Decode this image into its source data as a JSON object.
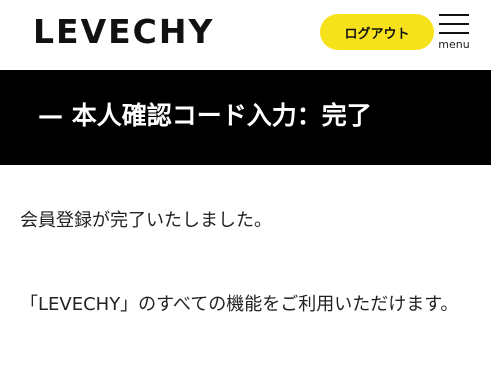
{
  "header": {
    "logo_text": "LEVECHY",
    "logout_label": "ログアウト",
    "menu_label": "menu",
    "logout_color": "#f6e21b"
  },
  "title_bar": {
    "title": "— 本人確認コード入力：完了",
    "background": "#000000"
  },
  "content": {
    "message_1": "会員登録が完了いたしました。",
    "message_2": "「LEVECHY」のすべての機能をご利用いただけます。"
  }
}
